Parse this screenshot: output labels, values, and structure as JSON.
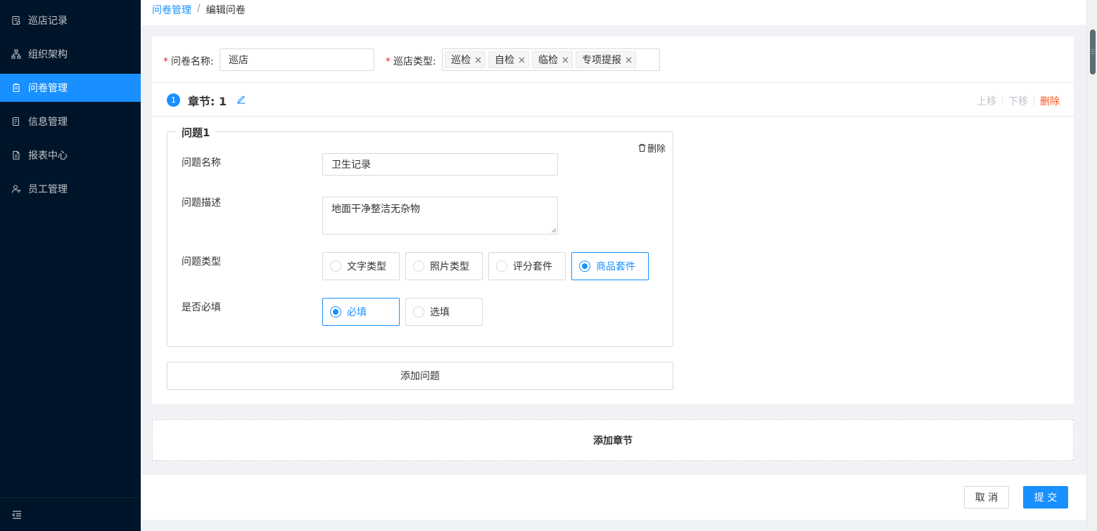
{
  "sidebar": {
    "items": [
      {
        "label": "巡店记录",
        "icon": "record-icon"
      },
      {
        "label": "组织架构",
        "icon": "org-tree-icon"
      },
      {
        "label": "问卷管理",
        "icon": "questionnaire-icon",
        "active": true
      },
      {
        "label": "信息管理",
        "icon": "info-doc-icon"
      },
      {
        "label": "报表中心",
        "icon": "report-icon"
      },
      {
        "label": "员工管理",
        "icon": "staff-icon"
      }
    ],
    "collapse_icon": "menu-fold-icon"
  },
  "breadcrumb": {
    "parent": "问卷管理",
    "separator": "/",
    "current": "编辑问卷"
  },
  "form": {
    "name_label": "问卷名称:",
    "name_value": "巡店",
    "type_label": "巡店类型:",
    "type_tags": [
      "巡检",
      "自检",
      "临检",
      "专项提报"
    ]
  },
  "section": {
    "number": "1",
    "title": "章节: 1",
    "actions": {
      "move_up": "上移",
      "move_down": "下移",
      "delete": "删除"
    }
  },
  "question": {
    "legend": "问题1",
    "delete_label": "删除",
    "name_label": "问题名称",
    "name_value": "卫生记录",
    "desc_label": "问题描述",
    "desc_value": "地面干净整洁无杂物",
    "type_label": "问题类型",
    "type_options": [
      "文字类型",
      "照片类型",
      "评分套件",
      "商品套件"
    ],
    "type_selected": "商品套件",
    "required_label": "是否必填",
    "required_options": [
      "必填",
      "选填"
    ],
    "required_selected": "必填"
  },
  "add_question_label": "添加问题",
  "add_section_label": "添加章节",
  "footer": {
    "cancel_label": "取 消",
    "submit_label": "提 交"
  },
  "colors": {
    "sidebar_bg": "#001529",
    "primary": "#1890ff",
    "danger": "#fa541c",
    "required_mark": "#f5222d"
  }
}
